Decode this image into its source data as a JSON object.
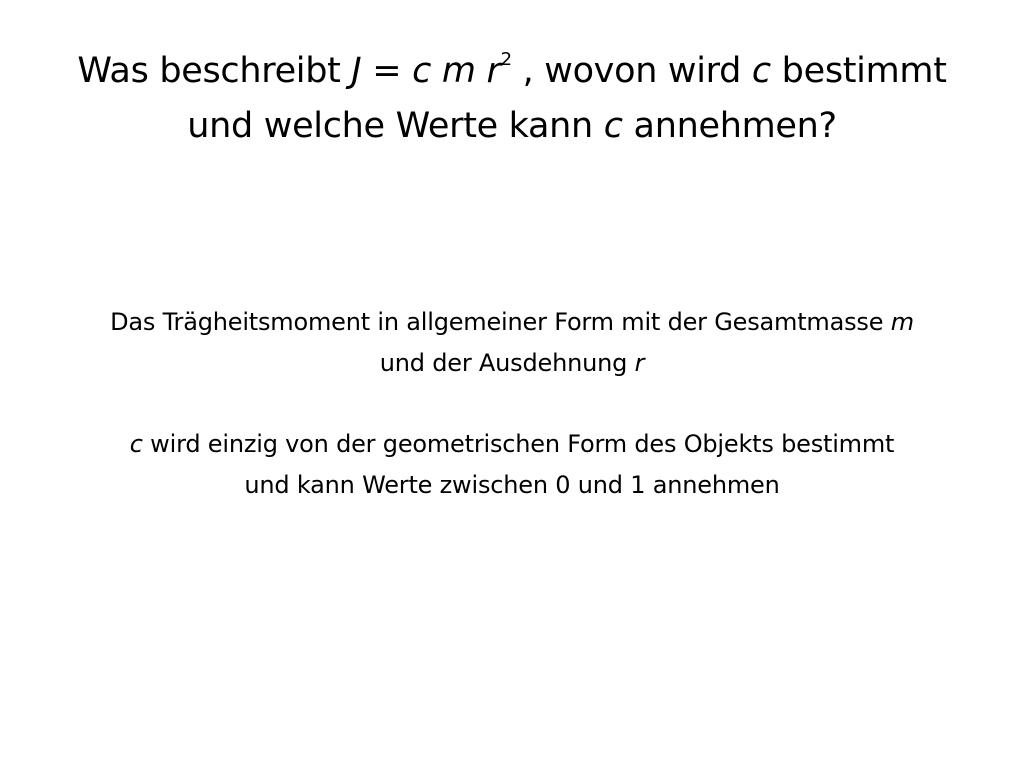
{
  "title": {
    "line1": {
      "prefix": "Was beschreibt ",
      "formula_J": "J",
      "formula_eq": " = ",
      "formula_c": "c",
      "formula_m": "m",
      "formula_r": "r",
      "formula_exp": "2",
      "suffix": " , wovon wird ",
      "var_c": "c",
      "end": " bestimmt"
    },
    "line2": {
      "prefix": "und welche Werte kann ",
      "var_c": "c",
      "end": " annehmen?"
    }
  },
  "answer_1": {
    "line1_text": "Das Trägheitsmoment in allgemeiner Form mit der Gesamtmasse ",
    "line1_var": "m",
    "line2_text": "und der Ausdehnung ",
    "line2_var": "r"
  },
  "answer_2": {
    "line1_var": "c",
    "line1_text": " wird einzig von der geometrischen Form des Objekts bestimmt",
    "line2_text": "und kann Werte zwischen 0 und 1 annehmen"
  }
}
